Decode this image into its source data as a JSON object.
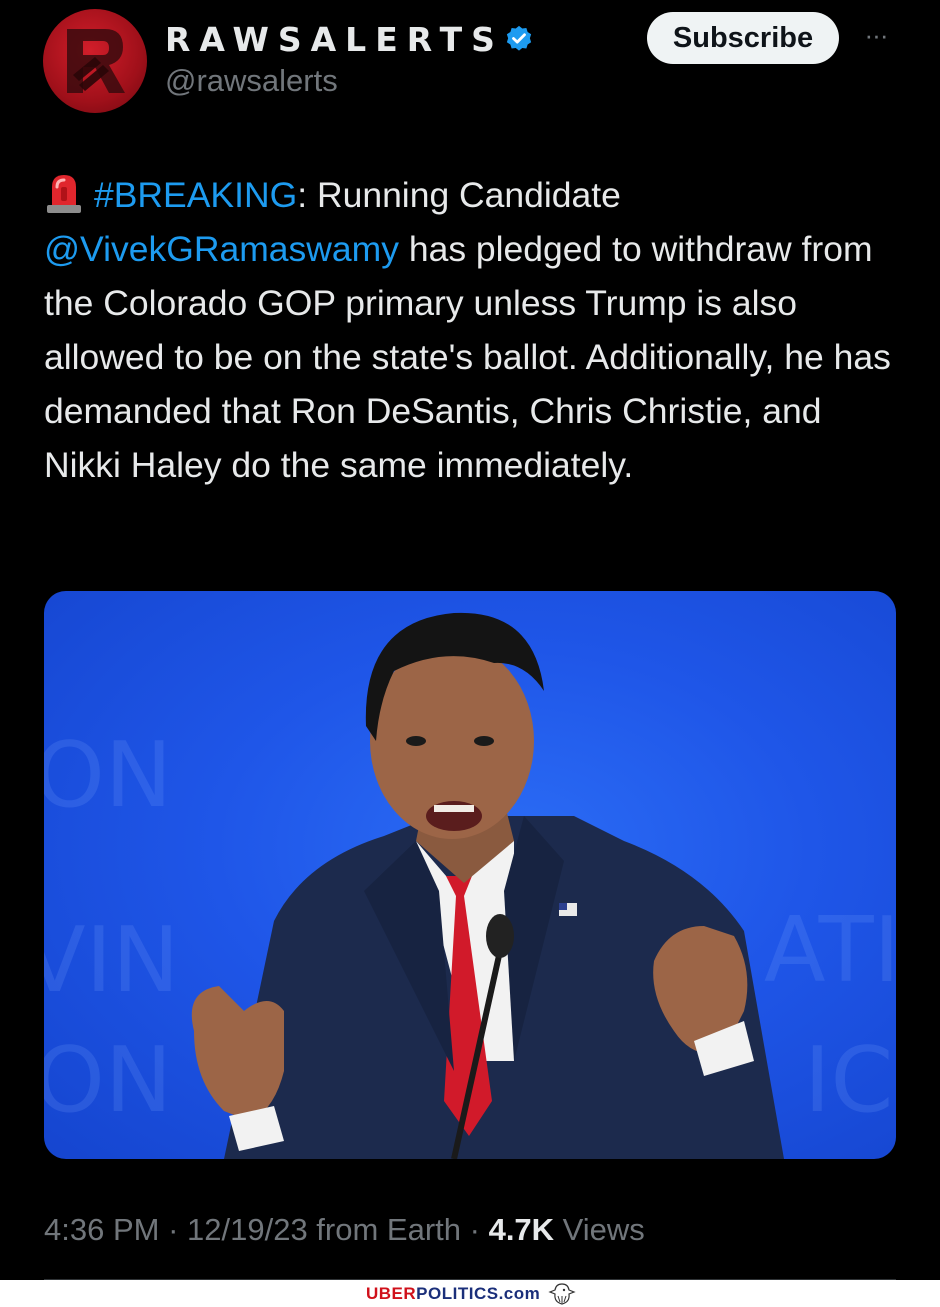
{
  "header": {
    "display_name": "RAWSALERTS",
    "handle": "@rawsalerts",
    "subscribe_label": "Subscribe",
    "more_label": "···",
    "avatar_icon": "rawsalerts-logo",
    "verified_icon": "verified-badge-icon"
  },
  "tweet": {
    "hashtag": "#BREAKING",
    "after_hashtag": ": Running Candidate ",
    "mention": "@VivekGRamaswamy",
    "body": " has pledged to withdraw from the Colorado GOP primary unless Trump is also allowed to be on the state's ballot. Additionally, he has demanded that Ron DeSantis, Chris Christie, and Nikki Haley do the same immediately.",
    "emoji_icon": "police-light-siren-icon"
  },
  "media": {
    "image_icon": "tweet-photo"
  },
  "meta": {
    "time": "4:36 PM",
    "separator": " · ",
    "date": "12/19/23",
    "source": " from Earth",
    "views_count": "4.7K",
    "views_label": " Views"
  },
  "watermark": {
    "part_red": "UBER",
    "part_blue": "POLITICS.com"
  },
  "colors": {
    "link": "#1d9bf0",
    "secondary_text": "#71767b",
    "background": "#000000",
    "watermark_red": "#d0111b",
    "watermark_blue": "#1b2f7a"
  }
}
